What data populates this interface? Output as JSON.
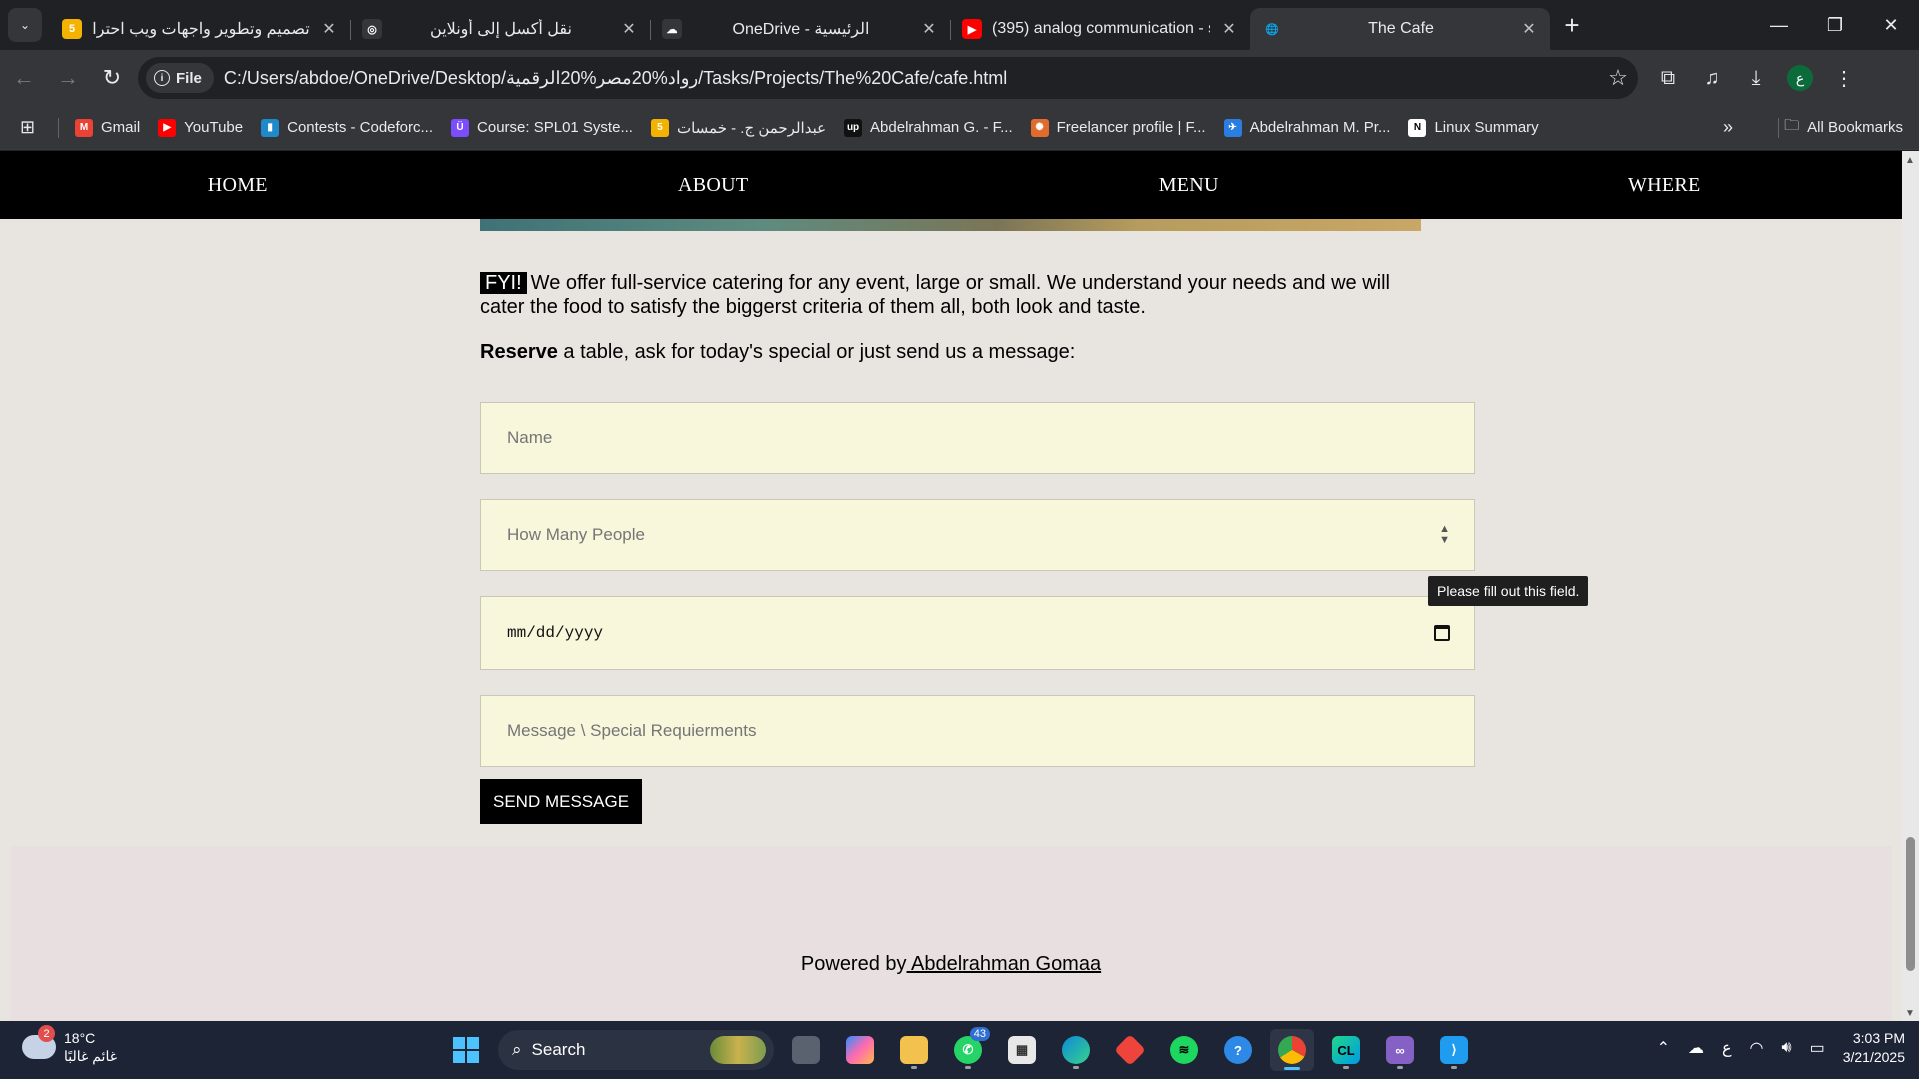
{
  "browser": {
    "tabs": [
      {
        "title": "تصميم وتطوير واجهات ويب احترا",
        "favicon": "5",
        "favicon_color": "#f5b301"
      },
      {
        "title": "نقل أكسل إلى أونلاين",
        "favicon": "◎",
        "favicon_color": "#35363a"
      },
      {
        "title": "OneDrive - الرئيسية",
        "favicon": "☁",
        "favicon_color": "#35363a"
      },
      {
        "title": "(395) analog communication - s",
        "favicon": "▶",
        "favicon_color": "#ff0000"
      },
      {
        "title": "The Cafe",
        "favicon": "🌐",
        "favicon_color": "#35363a",
        "active": true
      }
    ],
    "chip_label": "File",
    "url": "C:/Users/abdoe/OneDrive/Desktop/رواد%20مصر%20الرقمية/Tasks/Projects/The%20Cafe/cafe.html",
    "profile_initial": "ع",
    "bookmarks": [
      {
        "label": "Gmail",
        "icon": "M",
        "color": "#ea4335"
      },
      {
        "label": "YouTube",
        "icon": "▶",
        "color": "#ff0000"
      },
      {
        "label": "Contests - Codeforc...",
        "icon": "▮",
        "color": "#1f8acb"
      },
      {
        "label": "Course: SPL01 Syste...",
        "icon": "Ü",
        "color": "#7c4dff"
      },
      {
        "label": "عبدالرحمن ج. - خمسات",
        "icon": "5",
        "color": "#f5b301"
      },
      {
        "label": "Abdelrahman G. - F...",
        "icon": "up",
        "color": "#111111"
      },
      {
        "label": "Freelancer profile | F...",
        "icon": "✺",
        "color": "#e06b2d"
      },
      {
        "label": "Abdelrahman M. Pr...",
        "icon": "✈",
        "color": "#2a7de1"
      },
      {
        "label": "Linux Summary",
        "icon": "N",
        "color": "#ffffff"
      }
    ],
    "all_bookmarks": "All Bookmarks"
  },
  "page": {
    "nav": [
      "HOME",
      "ABOUT",
      "MENU",
      "WHERE"
    ],
    "fyi_tag": "FYI!",
    "fyi_text": "We offer full-service catering for any event, large or small. We understand your needs and we will cater the food to satisfy the biggerst criteria of them all, both look and taste.",
    "reserve_bold": "Reserve",
    "reserve_text": " a table, ask for today's special or just send us a message:",
    "form": {
      "name_placeholder": "Name",
      "people_placeholder": "How Many People",
      "date_placeholder": "mm/dd/yyyy",
      "message_placeholder": "Message \\ Special Requierments",
      "send_label": "SEND MESSAGE"
    },
    "tooltip": "Please fill out this field.",
    "footer_prefix": "Powered by",
    "footer_link": " Abdelrahman Gomaa"
  },
  "taskbar": {
    "weather_temp": "18°C",
    "weather_desc": "غائم غالبًا",
    "weather_badge": "2",
    "search_label": "Search",
    "whatsapp_badge": "43",
    "lang": "ع",
    "time": "3:03 PM",
    "date": "3/21/2025"
  }
}
